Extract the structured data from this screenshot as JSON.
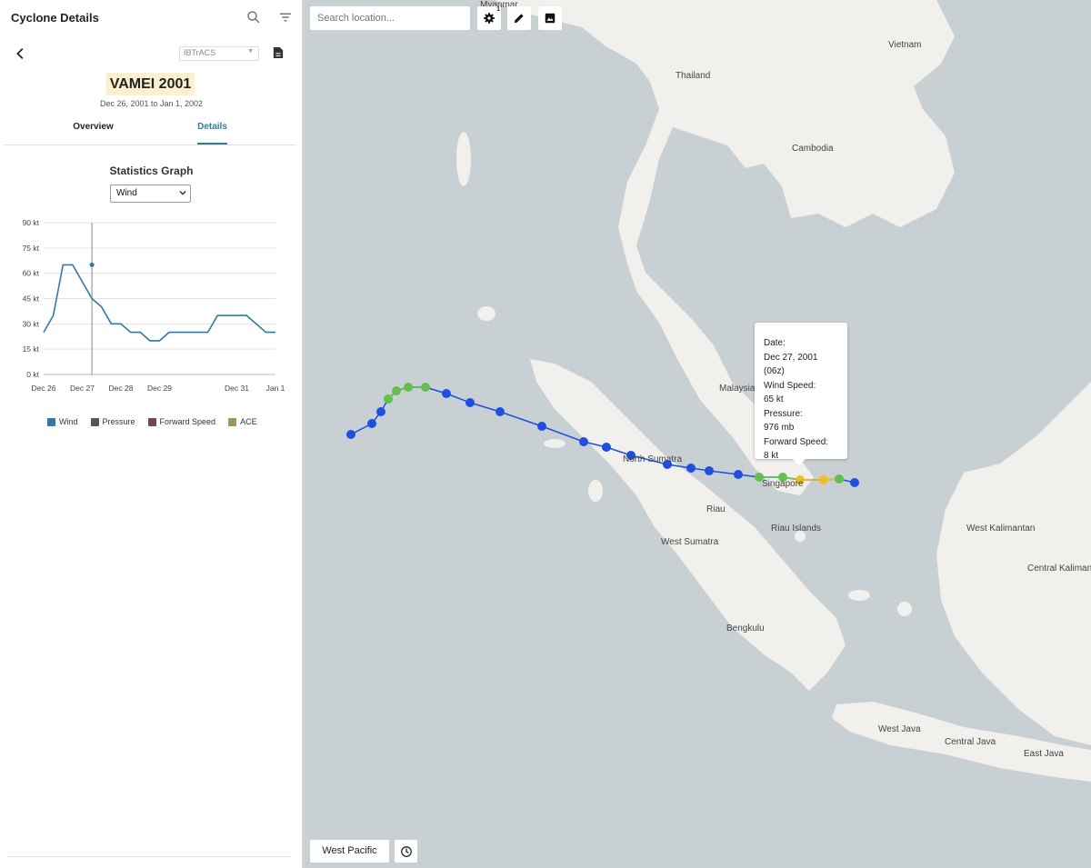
{
  "sidebar": {
    "title": "Cyclone Details",
    "source": "IBTrACS",
    "storm_name": "VAMEI 2001",
    "storm_dates": "Dec 26, 2001 to Jan 1, 2002",
    "tabs": [
      {
        "label": "Overview",
        "active": false
      },
      {
        "label": "Details",
        "active": true
      }
    ],
    "stats_title": "Statistics Graph",
    "metric": "Wind",
    "legend": [
      {
        "label": "Wind",
        "color": "#2e7aa8"
      },
      {
        "label": "Pressure",
        "color": "#555555"
      },
      {
        "label": "Forward Speed",
        "color": "#6e4b49"
      },
      {
        "label": "ACE",
        "color": "#a3945b"
      }
    ]
  },
  "chart_data": {
    "type": "line",
    "title": "",
    "xlabel": "",
    "ylabel": "",
    "y_tick_labels": [
      "0 kt",
      "15 kt",
      "30 kt",
      "45 kt",
      "60 kt",
      "75 kt",
      "90 kt"
    ],
    "x_tick_labels": [
      "Dec 26",
      "Dec 27",
      "Dec 28",
      "Dec 29",
      "Dec 31",
      "Jan 1"
    ],
    "ylim": [
      0,
      90
    ],
    "grid": true,
    "line_color": "#2e7aa8",
    "series": [
      {
        "name": "Wind",
        "x": [
          "2001-12-26 00z",
          "2001-12-26 06z",
          "2001-12-26 12z",
          "2001-12-26 18z",
          "2001-12-27 06z",
          "2001-12-27 12z",
          "2001-12-27 18z",
          "2001-12-28 00z",
          "2001-12-28 06z",
          "2001-12-28 12z",
          "2001-12-28 18z",
          "2001-12-29 00z",
          "2001-12-29 06z",
          "2001-12-29 12z",
          "2001-12-29 18z",
          "2001-12-30 00z",
          "2001-12-30 06z",
          "2001-12-30 12z",
          "2001-12-30 18z",
          "2001-12-31 00z",
          "2001-12-31 06z",
          "2001-12-31 12z",
          "2001-12-31 18z",
          "2002-01-01 00z"
        ],
        "values": [
          25,
          35,
          65,
          65,
          45,
          40,
          30,
          30,
          25,
          25,
          20,
          20,
          25,
          25,
          25,
          25,
          25,
          35,
          35,
          35,
          35,
          30,
          25,
          25
        ]
      }
    ],
    "highlight": {
      "x": "2001-12-27 06z",
      "value": 65
    }
  },
  "map": {
    "search_placeholder": "Search location...",
    "settings_badge": "1",
    "region_button": "West Pacific",
    "labels": [
      "Myanmar",
      "Thailand",
      "Vietnam",
      "Cambodia",
      "Malaysia",
      "North Sumatra",
      "Singapore",
      "Riau",
      "Riau Islands",
      "West Sumatra",
      "Bengkulu",
      "West Kalimantan",
      "Central Kalimantan",
      "West Java",
      "Central Java",
      "East Java"
    ],
    "track_colors": {
      "depression": "#1f4fe0",
      "storm": "#63c04a",
      "typhoon": "#f0be1e"
    },
    "tooltip": {
      "date_label": "Date:",
      "date_value": "Dec 27, 2001 (06z)",
      "wind_label": "Wind Speed:",
      "wind_value": "65 kt",
      "pressure_label": "Pressure:",
      "pressure_value": "976 mb",
      "fwd_label": "Forward Speed:",
      "fwd_value": "8 kt"
    }
  }
}
